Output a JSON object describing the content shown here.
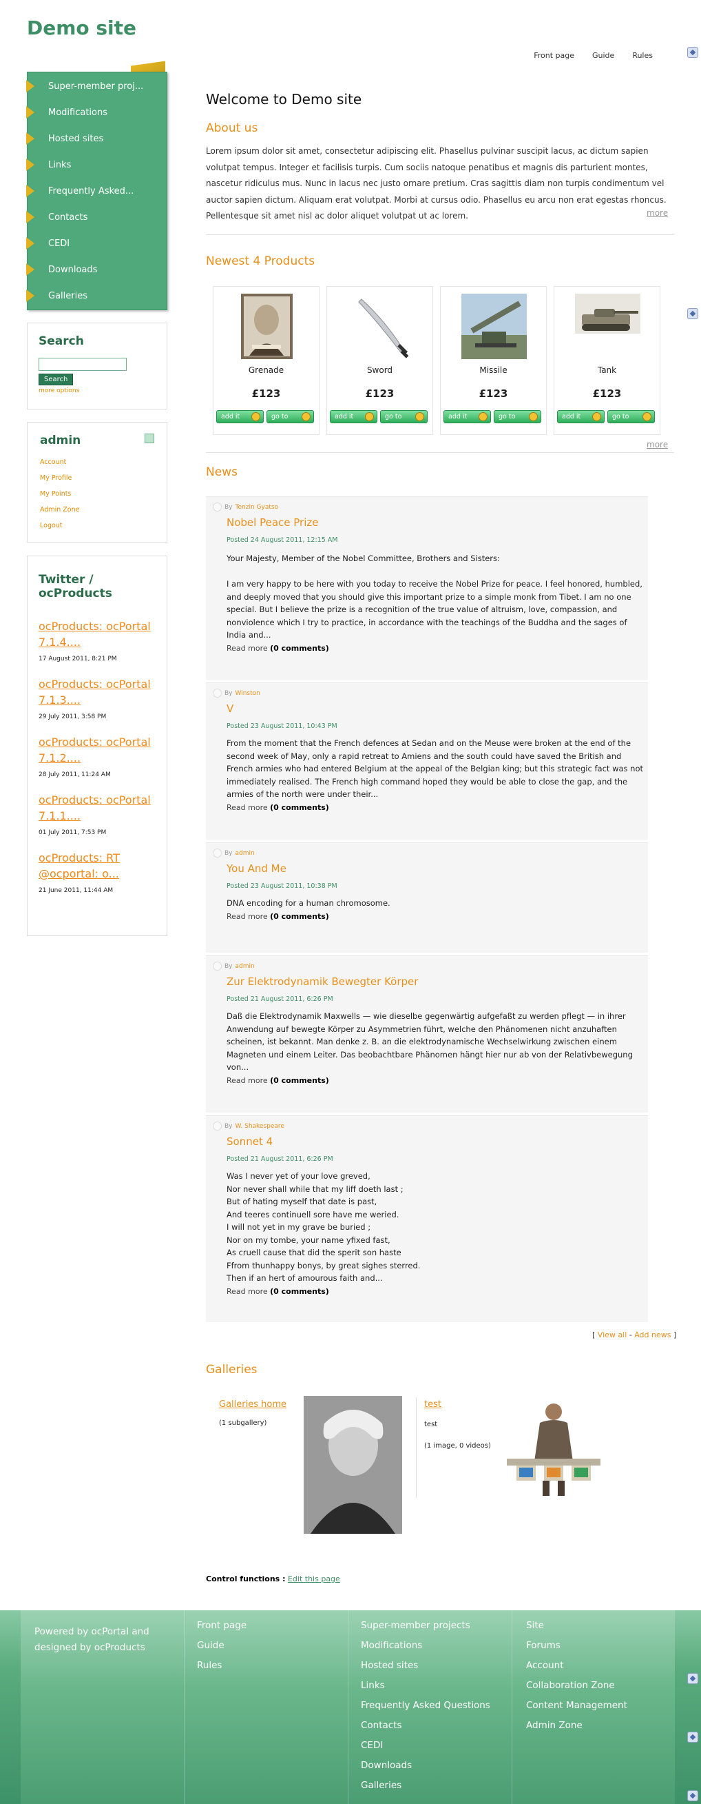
{
  "site": {
    "title": "Demo site"
  },
  "top_nav": [
    "Front page",
    "Guide",
    "Rules"
  ],
  "menu": [
    "Super-member proj...",
    "Modifications",
    "Hosted sites",
    "Links",
    "Frequently Asked...",
    "Contacts",
    "CEDI",
    "Downloads",
    "Galleries"
  ],
  "search": {
    "title": "Search",
    "button": "Search",
    "more_options": "more options"
  },
  "admin": {
    "title": "admin",
    "links": [
      "Account",
      "My Profile",
      "My Points",
      "Admin Zone",
      "Logout"
    ]
  },
  "twitter": {
    "title_line1": "Twitter /",
    "title_line2": "ocProducts",
    "tweets": [
      {
        "text1": "ocProducts: ocPortal",
        "text2": "7.1.4....",
        "date": "17 August 2011, 8:21 PM"
      },
      {
        "text1": "ocProducts: ocPortal",
        "text2": "7.1.3....",
        "date": "29 July 2011, 3:58 PM"
      },
      {
        "text1": "ocProducts: ocPortal",
        "text2": "7.1.2....",
        "date": "28 July 2011, 11:24 AM"
      },
      {
        "text1": "ocProducts: ocPortal",
        "text2": "7.1.1....",
        "date": "01 July 2011, 7:53 PM"
      },
      {
        "text1": "ocProducts: RT",
        "text2": "@ocportal: o...",
        "date": "21 June 2011, 11:44 AM"
      }
    ]
  },
  "main": {
    "welcome": "Welcome to Demo site",
    "about_title": "About us",
    "about_text": "Lorem ipsum dolor sit amet, consectetur adipiscing elit. Phasellus pulvinar suscipit lacus, ac dictum sapien volutpat tempus. Integer et facilisis turpis. Cum sociis natoque penatibus et magnis dis parturient montes, nascetur ridiculus mus. Nunc in lacus nec justo ornare pretium. Cras sagittis diam non turpis condimentum vel auctor sapien dictum. Aliquam erat volutpat. Morbi at cursus odio. Phasellus eu arcu non erat egestas rhoncus. Pellentesque sit amet nisl ac dolor aliquet volutpat ut ac lorem.",
    "more": "more",
    "products_title": "Newest 4 Products",
    "products": [
      {
        "name": "Grenade",
        "price": "£123"
      },
      {
        "name": "Sword",
        "price": "£123"
      },
      {
        "name": "Missile",
        "price": "£123"
      },
      {
        "name": "Tank",
        "price": "£123"
      }
    ],
    "add_it": "add it",
    "go_to": "go to",
    "news_title": "News",
    "by": "By",
    "read_more": "Read more",
    "news": [
      {
        "author": "Tenzin Gyatso",
        "title": "Nobel Peace Prize",
        "posted": "Posted 24 August 2011, 12:15 AM",
        "body": "Your Majesty, Member of the Nobel Committee, Brothers and Sisters:\n\nI am very happy to be here with you today to receive the Nobel Prize for peace. I feel honored, humbled, and deeply moved that you should give this important prize to a simple monk from Tibet. I am no one special. But I believe the prize is a recognition of the true value of altruism, love, compassion, and nonviolence which I try to practice, in accordance with the teachings of the Buddha and the sages of India and...",
        "comments": "(0 comments)"
      },
      {
        "author": "Winston",
        "title": "V",
        "posted": "Posted 23 August 2011, 10:43 PM",
        "body": "From the moment that the French defences at Sedan and on the Meuse were broken at the end of the second week of May, only a rapid retreat to Amiens and the south could have saved the British and French armies who had entered Belgium at the appeal of the Belgian king; but this strategic fact was not immediately realised. The French high command hoped they would be able to close the gap, and the armies of the north were under their...",
        "comments": "(0 comments)"
      },
      {
        "author": "admin",
        "title": "You And Me",
        "posted": "Posted 23 August 2011, 10:38 PM",
        "body": "DNA encoding for a human chromosome.",
        "comments": "(0 comments)"
      },
      {
        "author": "admin",
        "title": "Zur Elektrodynamik Bewegter Körper",
        "posted": "Posted 21 August 2011, 6:26 PM",
        "body": "Daß die Elektrodynamik Maxwells — wie dieselbe gegenwärtig aufgefaßt zu werden pflegt — in ihrer Anwendung auf bewegte Körper zu Asymmetrien führt, welche den Phänomenen nicht anzuhaften scheinen, ist bekannt. Man denke z. B. an die elektrodynamische Wechselwirkung zwischen einem Magneten und einem Leiter. Das beobachtbare Phänomen hängt hier nur ab von der Relativbewegung von...",
        "comments": "(0 comments)"
      },
      {
        "author": "W. Shakespeare",
        "title": "Sonnet 4",
        "posted": "Posted 21 August 2011, 6:26 PM",
        "body": "Was I never yet of your love greved,\nNor never shall while that my liff doeth last ;\nBut of hating myself that date is past,\nAnd teeres continuell sore have me weried.\nI will not yet in my grave be buried ;\nNor on my tombe, your name yfixed fast,\nAs cruell cause that did the sperit son haste\nFfrom thunhappy bonys, by great sighes sterred.\nThen if an hert of amourous faith and...",
        "comments": "(0 comments)"
      }
    ],
    "view_all": "View all",
    "add_news": "Add news",
    "galleries_title": "Galleries",
    "gallery_home": "Galleries home",
    "gallery_home_sub": "(1 subgallery)",
    "gallery_test": "test",
    "gallery_test_desc": "test",
    "gallery_test_sub": "(1 image, 0 videos)",
    "control_label": "Control functions :",
    "edit_page": "Edit this page"
  },
  "footer": {
    "powered_prefix": "Powered by",
    "ocportal": "ocPortal",
    "and": "and",
    "designed_by": "designed by",
    "ocproducts": "ocProducts",
    "col1": [
      "Front page",
      "Guide",
      "Rules"
    ],
    "col2": [
      "Super-member projects",
      "Modifications",
      "Hosted sites",
      "Links",
      "Frequently Asked Questions",
      "Contacts",
      "CEDI",
      "Downloads",
      "Galleries"
    ],
    "col3": [
      "Site",
      "Forums",
      "Account",
      "Collaboration Zone",
      "Content Management",
      "Admin Zone"
    ]
  },
  "colors": {
    "brand_green": "#4fa97b",
    "accent_orange": "#e8901a",
    "menu_arrow": "#e0b21f"
  }
}
